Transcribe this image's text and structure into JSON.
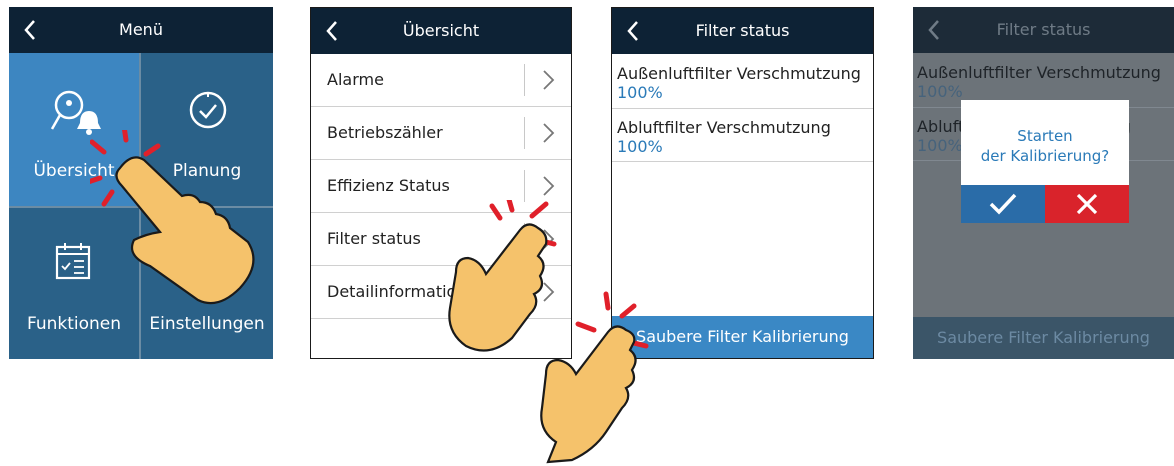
{
  "screens": {
    "menu": {
      "title": "Menü",
      "tiles": [
        {
          "label": "Übersicht",
          "icon": "search-bell-icon"
        },
        {
          "label": "Planung",
          "icon": "clock-check-icon"
        },
        {
          "label": "Funktionen",
          "icon": "calendar-list-icon"
        },
        {
          "label": "Einstellungen",
          "icon": "wrench-icon"
        }
      ]
    },
    "overview": {
      "title": "Übersicht",
      "items": [
        "Alarme",
        "Betriebszähler",
        "Effizienz Status",
        "Filter status",
        "Detailinformation"
      ]
    },
    "filter": {
      "title": "Filter status",
      "rows": [
        {
          "name": "Außenluftfilter Verschmutzung",
          "value": "100%"
        },
        {
          "name": "Abluftfilter Verschmutzung",
          "value": "100%"
        }
      ],
      "button": "Saubere Filter Kalibrierung"
    },
    "dialog": {
      "title": "Filter status",
      "rows": [
        {
          "name": "Außenluftfilter Verschmutzung",
          "value": "100%"
        },
        {
          "name": "Abluftfilter Verschmutzung",
          "value": "100%"
        }
      ],
      "button": "Saubere Filter Kalibrierung",
      "prompt_line1": "Starten",
      "prompt_line2": "der Kalibrierung?",
      "confirm_icon": "check-icon",
      "cancel_icon": "close-icon"
    }
  },
  "colors": {
    "header": "#0d2235",
    "tile": "#2a6188",
    "tile_selected": "#3d86c1",
    "accent": "#3a88c5",
    "value": "#2a7ab8",
    "confirm": "#2a6ca8",
    "cancel": "#d9232b",
    "hand": "#f5c26b",
    "tap": "#e0202a"
  }
}
